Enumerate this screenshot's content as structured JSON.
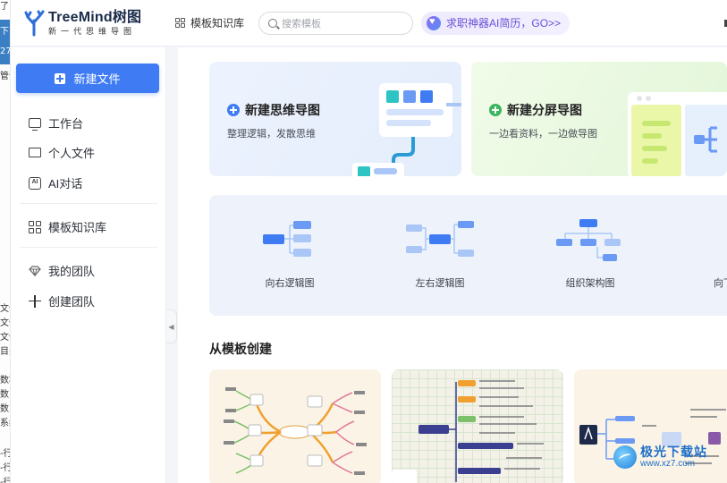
{
  "app": {
    "name": "TreeMind树图",
    "tagline": "新一代思维导图"
  },
  "header": {
    "templates_label": "模板知识库",
    "search_placeholder": "搜索模板",
    "promo_label": "求职神器AI简历，GO>>"
  },
  "sidebar": {
    "new_file_label": "新建文件",
    "items": [
      {
        "label": "工作台",
        "icon": "monitor-icon"
      },
      {
        "label": "个人文件",
        "icon": "folder-icon"
      },
      {
        "label": "AI对话",
        "icon": "ai-chat-icon"
      },
      {
        "label": "模板知识库",
        "icon": "grid-icon"
      },
      {
        "label": "我的团队",
        "icon": "team-icon"
      },
      {
        "label": "创建团队",
        "icon": "plus-icon"
      }
    ]
  },
  "main": {
    "cards": [
      {
        "title": "新建思维导图",
        "desc": "整理逻辑，发散思维",
        "accent": "#3f7cf4"
      },
      {
        "title": "新建分屏导图",
        "desc": "一边看资料，一边做导图",
        "accent": "#3bb55e"
      }
    ],
    "structures": [
      {
        "label": "向右逻辑图"
      },
      {
        "label": "左右逻辑图"
      },
      {
        "label": "组织架构图"
      },
      {
        "label": "向下"
      }
    ],
    "section_title": "从模板创建",
    "template_cards": [
      {
        "name": "template-mindmap-warm"
      },
      {
        "name": "template-grid-list"
      },
      {
        "name": "template-timeline"
      }
    ]
  },
  "background_fragments": [
    "了",
    "下",
    "27",
    "管信",
    "文件",
    "文件",
    "文件",
    "目关",
    "数程",
    "数",
    "数",
    "系统",
    "-行",
    "-行",
    "-行"
  ],
  "watermark": {
    "title": "极光下载站",
    "url": "www.xz7.com"
  },
  "colors": {
    "primary": "#3f7cf4",
    "node_blue": "#3f7cf4",
    "node_light": "#a9c6f7"
  }
}
